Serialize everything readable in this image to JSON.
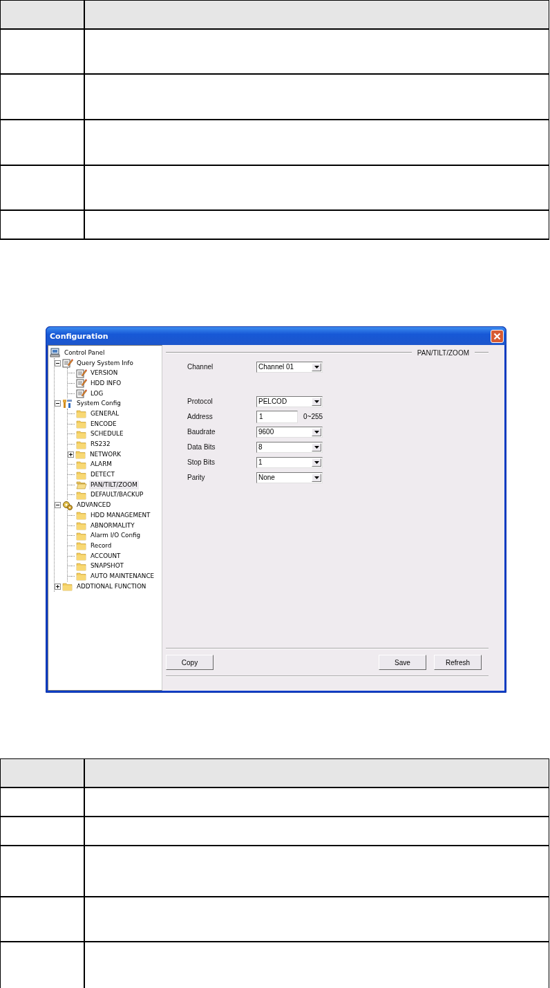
{
  "window": {
    "title": "Configuration"
  },
  "tree": [
    {
      "label": "Control Panel",
      "kind": "computer",
      "selected": false,
      "children": [
        {
          "label": "Query System Info",
          "kind": "note",
          "expanded": true,
          "selected": false,
          "children": [
            {
              "label": "VERSION",
              "kind": "note",
              "selected": false
            },
            {
              "label": "HDD INFO",
              "kind": "note",
              "selected": false
            },
            {
              "label": "LOG",
              "kind": "note",
              "selected": false
            }
          ]
        },
        {
          "label": "System Config",
          "kind": "tools",
          "expanded": true,
          "selected": false,
          "children": [
            {
              "label": "GENERAL",
              "kind": "folder",
              "selected": false
            },
            {
              "label": "ENCODE",
              "kind": "folder",
              "selected": false
            },
            {
              "label": "SCHEDULE",
              "kind": "folder",
              "selected": false
            },
            {
              "label": "RS232",
              "kind": "folder",
              "selected": false
            },
            {
              "label": "NETWORK",
              "kind": "folder",
              "expanded": false,
              "selected": false
            },
            {
              "label": "ALARM",
              "kind": "folder",
              "selected": false
            },
            {
              "label": "DETECT",
              "kind": "folder",
              "selected": false
            },
            {
              "label": "PAN/TILT/ZOOM",
              "kind": "folder",
              "selected": true
            },
            {
              "label": "DEFAULT/BACKUP",
              "kind": "folder",
              "selected": false
            }
          ]
        },
        {
          "label": "ADVANCED",
          "kind": "gears",
          "expanded": true,
          "selected": false,
          "children": [
            {
              "label": "HDD MANAGEMENT",
              "kind": "folder",
              "selected": false
            },
            {
              "label": "ABNORMALITY",
              "kind": "folder",
              "selected": false
            },
            {
              "label": "Alarm I/O Config",
              "kind": "folder",
              "selected": false
            },
            {
              "label": "Record",
              "kind": "folder",
              "selected": false
            },
            {
              "label": "ACCOUNT",
              "kind": "folder",
              "selected": false
            },
            {
              "label": "SNAPSHOT",
              "kind": "folder",
              "selected": false
            },
            {
              "label": "AUTO MAINTENANCE",
              "kind": "folder",
              "selected": false
            }
          ]
        },
        {
          "label": "ADDTIONAL FUNCTION",
          "kind": "folder",
          "expanded": false,
          "selected": false
        }
      ]
    }
  ],
  "panel": {
    "title": "PAN/TILT/ZOOM",
    "channel": {
      "label": "Channel",
      "kind": "select",
      "value": "Channel 01"
    },
    "fields": [
      {
        "label": "Protocol",
        "kind": "select",
        "value": "PELCOD"
      },
      {
        "label": "Address",
        "kind": "input",
        "value": "1",
        "range": "0~255"
      },
      {
        "label": "Baudrate",
        "kind": "select",
        "value": "9600"
      },
      {
        "label": "Data Bits",
        "kind": "select",
        "value": "8"
      },
      {
        "label": "Stop Bits",
        "kind": "select",
        "value": "1"
      },
      {
        "label": "Parity",
        "kind": "select",
        "value": "None"
      }
    ],
    "buttons_left": [
      "Copy"
    ],
    "buttons_right": [
      "Save",
      "Refresh"
    ]
  }
}
